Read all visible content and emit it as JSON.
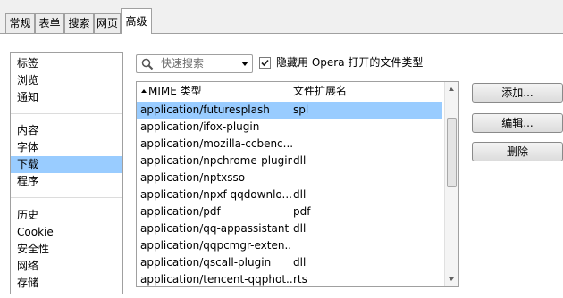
{
  "tabs": [
    {
      "label": "常规",
      "active": false
    },
    {
      "label": "表单",
      "active": false
    },
    {
      "label": "搜索",
      "active": false
    },
    {
      "label": "网页",
      "active": false
    },
    {
      "label": "高级",
      "active": true
    }
  ],
  "sidebar": {
    "groups": [
      [
        "标签",
        "浏览",
        "通知"
      ],
      [
        "内容",
        "字体",
        "下载",
        "程序"
      ],
      [
        "历史",
        "Cookie",
        "安全性",
        "网络",
        "存储"
      ]
    ],
    "selected": "下载"
  },
  "search": {
    "placeholder": "快速搜索",
    "icon": "search-icon"
  },
  "hide_opera_types": {
    "label": "隐藏用 Opera 打开的文件类型",
    "checked": true
  },
  "table": {
    "columns": [
      "MIME 类型",
      "文件扩展名"
    ],
    "sort_column": "MIME 类型",
    "rows": [
      {
        "mime": "application/futuresplash",
        "ext": "spl",
        "selected": true
      },
      {
        "mime": "application/ifox-plugin",
        "ext": ""
      },
      {
        "mime": "application/mozilla-ccbenc...",
        "ext": ""
      },
      {
        "mime": "application/npchrome-plugin",
        "ext": "dll"
      },
      {
        "mime": "application/nptxsso",
        "ext": ""
      },
      {
        "mime": "application/npxf-qqdownlo...",
        "ext": "dll"
      },
      {
        "mime": "application/pdf",
        "ext": "pdf"
      },
      {
        "mime": "application/qq-appassistant",
        "ext": "dll"
      },
      {
        "mime": "application/qqpcmgr-exten...",
        "ext": ""
      },
      {
        "mime": "application/qscall-plugin",
        "ext": "dll"
      },
      {
        "mime": "application/tencent-qqphot...",
        "ext": "rts"
      }
    ]
  },
  "buttons": {
    "add": "添加...",
    "edit": "编辑...",
    "delete": "删除"
  },
  "colors": {
    "selection": "#99ccff",
    "border": "#a0a0a0"
  }
}
